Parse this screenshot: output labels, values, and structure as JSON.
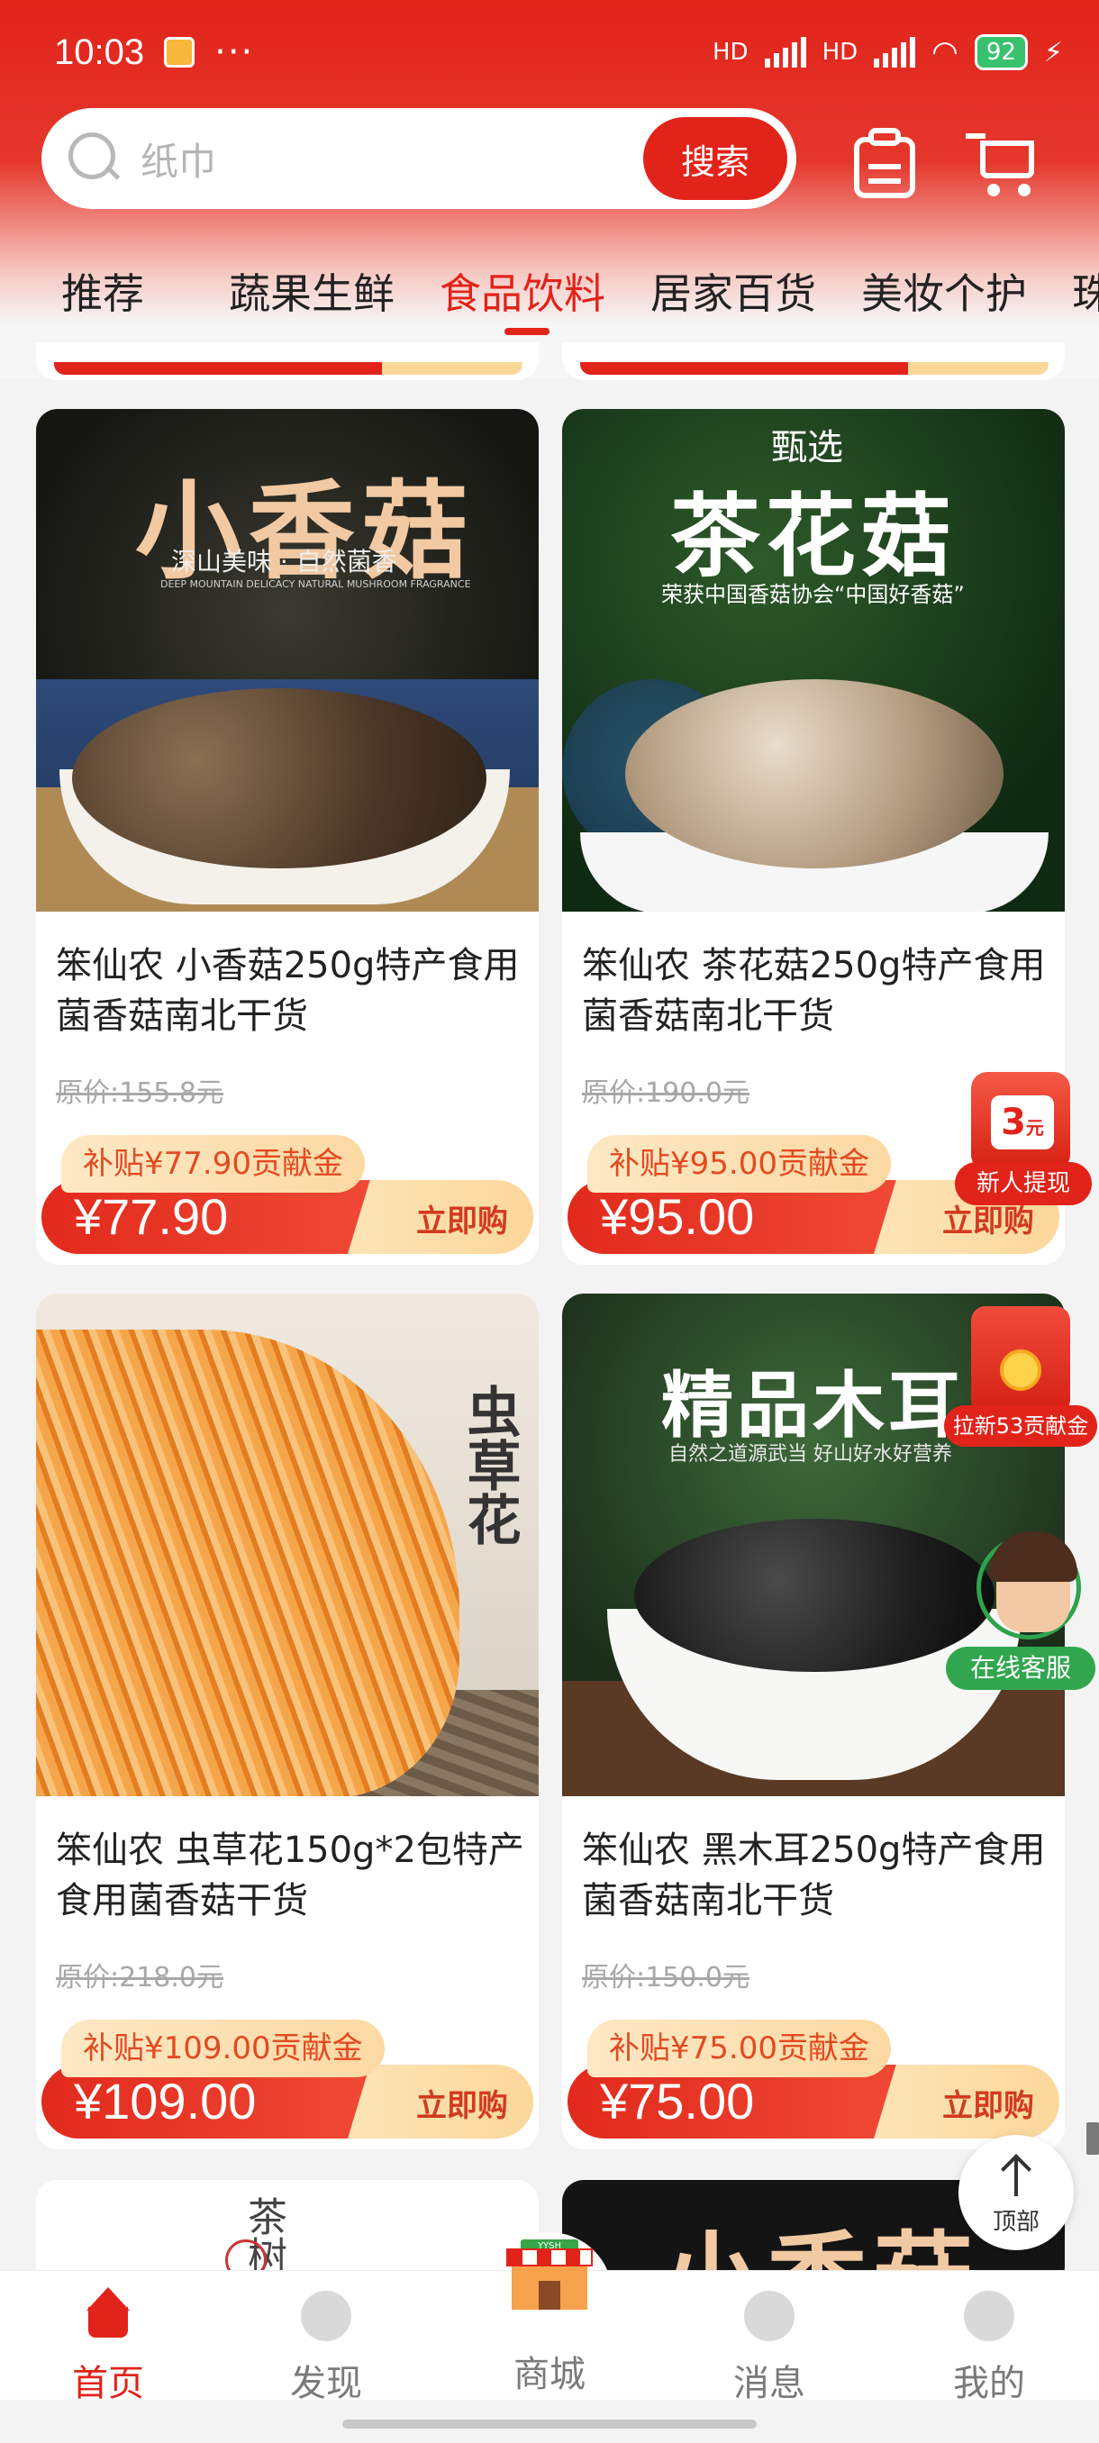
{
  "status_bar": {
    "time": "10:03",
    "dots": "···",
    "network_1": "HD",
    "network_2": "HD",
    "battery": "92"
  },
  "search": {
    "placeholder": "纸巾",
    "button": "搜索"
  },
  "categories": {
    "active_index": 2,
    "items": [
      "推荐",
      "蔬果生鲜",
      "食品饮料",
      "居家百货",
      "美妆个护",
      "珠"
    ]
  },
  "products": [
    {
      "image_title": "小香菇",
      "image_subtitle": "深山美味 · 自然菌香",
      "image_caption": "DEEP MOUNTAIN DELICACY NATURAL MUSHROOM FRAGRANCE",
      "title": "笨仙农 小香菇250g特产食用菌香菇南北干货",
      "original_price": "原价:155.8元",
      "subsidy": "补贴¥77.90贡献金",
      "price": "¥77.90",
      "buy_label": "立即购"
    },
    {
      "image_badge": "甄选",
      "image_title": "茶花菇",
      "image_subtitle": "荣获中国香菇协会“中国好香菇”",
      "title": "笨仙农 茶花菇250g特产食用菌香菇南北干货",
      "original_price": "原价:190.0元",
      "subsidy": "补贴¥95.00贡献金",
      "price": "¥95.00",
      "buy_label": "立即购"
    },
    {
      "image_title": "虫草花",
      "title": "笨仙农 虫草花150g*2包特产食用菌香菇干货",
      "original_price": "原价:218.0元",
      "subsidy": "补贴¥109.00贡献金",
      "price": "¥109.00",
      "buy_label": "立即购"
    },
    {
      "image_title": "精品木耳",
      "image_subtitle": "自然之道源武当 好山好水好营养",
      "title": "笨仙农 黑木耳250g特产食用菌香菇南北干货",
      "original_price": "原价:150.0元",
      "subsidy": "补贴¥75.00贡献金",
      "price": "¥75.00",
      "buy_label": "立即购"
    }
  ],
  "partial_cards": {
    "left_text": "茶树",
    "right_text": "小香菇"
  },
  "floating": {
    "newuser_amount": "3",
    "newuser_unit": "元",
    "newuser_label": "新人提现",
    "invite_label": "拉新53贡献金",
    "service_label": "在线客服",
    "top_label": "顶部"
  },
  "bottom_nav": {
    "active_index": 0,
    "mall_sign": "YYSH",
    "items": [
      "首页",
      "发现",
      "商城",
      "消息",
      "我的"
    ]
  },
  "colors": {
    "brand_red": "#e2231a",
    "gold": "#fbd79a",
    "service_green": "#31a64f"
  }
}
